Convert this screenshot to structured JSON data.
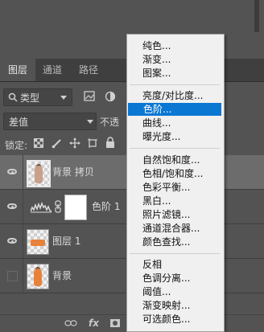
{
  "tabs": [
    "图层",
    "通道",
    "路径"
  ],
  "filter": {
    "kind_label": "类型"
  },
  "blend": {
    "mode": "差值",
    "opacity_label": "不透"
  },
  "lock": {
    "label": "锁定:"
  },
  "layers": [
    {
      "name": "背景 拷贝",
      "selected": true,
      "visible": true
    },
    {
      "name": "色阶 1",
      "selected": false,
      "visible": true
    },
    {
      "name": "图层 1",
      "selected": false,
      "visible": true
    },
    {
      "name": "背景",
      "selected": false,
      "visible": false
    }
  ],
  "bottom_bar": {
    "fx_label": "fx"
  },
  "menu": {
    "groups": [
      [
        "纯色...",
        "渐变...",
        "图案..."
      ],
      [
        "亮度/对比度...",
        "色阶...",
        "曲线...",
        "曝光度..."
      ],
      [
        "自然饱和度...",
        "色相/饱和度...",
        "色彩平衡...",
        "黑白...",
        "照片滤镜...",
        "通道混合器...",
        "颜色查找..."
      ],
      [
        "反相",
        "色调分离...",
        "阈值...",
        "渐变映射...",
        "可选颜色..."
      ]
    ],
    "highlighted": "色阶..."
  },
  "colors": {
    "highlight": "#0a77d3",
    "panel": "#535353",
    "menu_bg": "#f0f0f0"
  }
}
